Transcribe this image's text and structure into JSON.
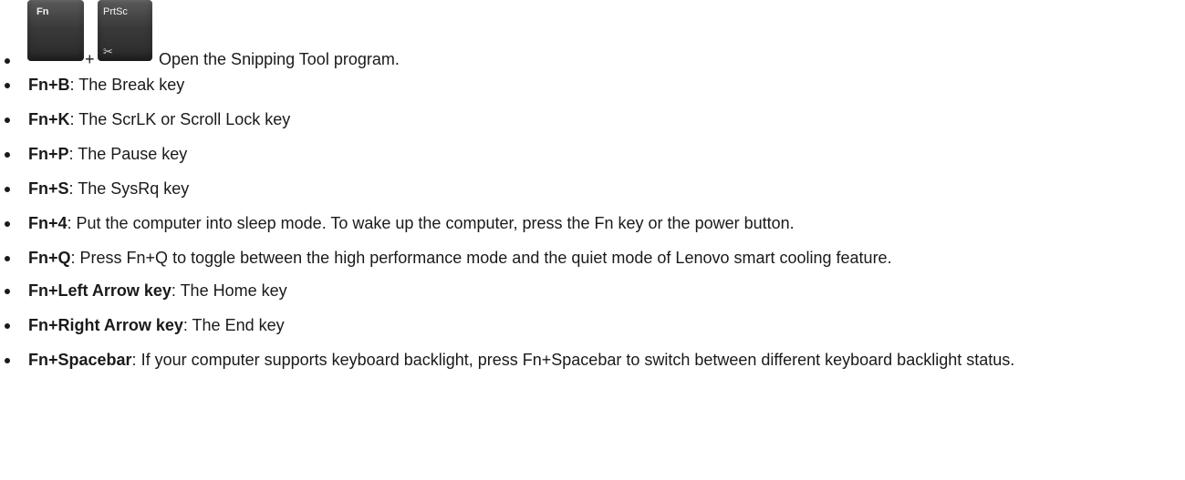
{
  "keys": {
    "fn": "Fn",
    "prtsc": "PrtSc",
    "plus": "+",
    "snip_icon_name": "scissors-icon"
  },
  "first_item": {
    "text": "Open the Snipping Tool program."
  },
  "items": [
    {
      "combo": "Fn+B",
      "sep": ": ",
      "text": "The Break key"
    },
    {
      "combo": "Fn+K",
      "sep": ": ",
      "text": "The ScrLK or Scroll Lock key"
    },
    {
      "combo": "Fn+P",
      "sep": ": ",
      "text": "The Pause key"
    },
    {
      "combo": "Fn+S",
      "sep": ": ",
      "text": "The SysRq key"
    },
    {
      "combo": "Fn+4",
      "sep": ": ",
      "text": "Put the computer into sleep mode. To wake up the computer, press the Fn key or the power button."
    },
    {
      "combo": "Fn+Q",
      "sep": ": ",
      "text": "Press Fn+Q to toggle between the high performance mode and the quiet mode of Lenovo smart cooling feature."
    },
    {
      "combo": "Fn+Left Arrow key",
      "sep": ": ",
      "text": "The Home key"
    },
    {
      "combo": "Fn+Right Arrow key",
      "sep": ": ",
      "text": "The End key"
    },
    {
      "combo": "Fn+Spacebar",
      "sep": ": ",
      "text": "If your computer supports keyboard backlight, press Fn+Spacebar to switch between different keyboard backlight status."
    }
  ]
}
